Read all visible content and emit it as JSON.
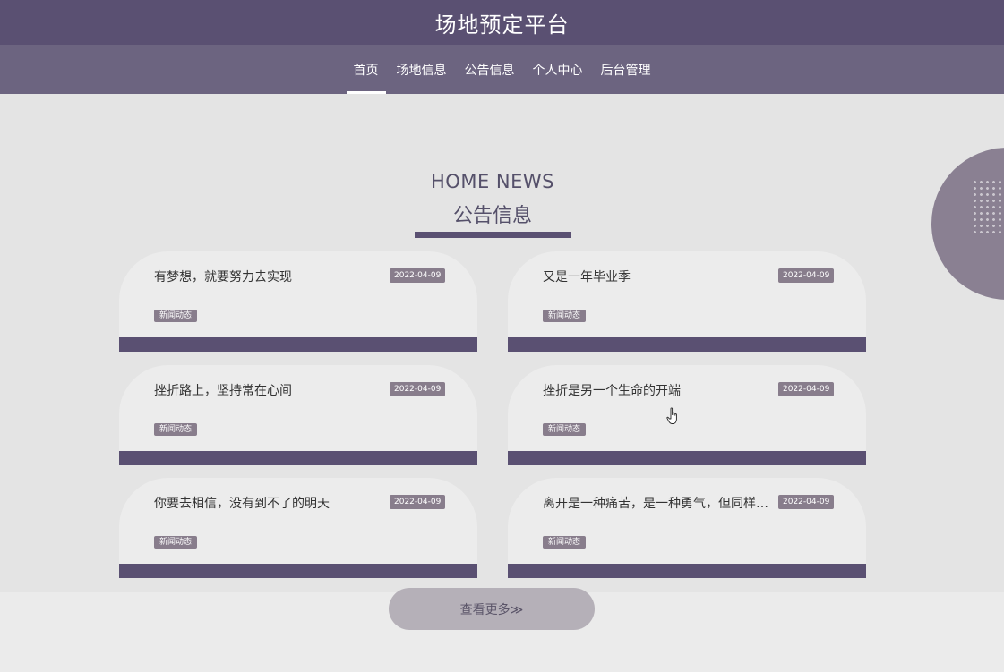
{
  "header": {
    "title": "场地预定平台"
  },
  "nav": [
    {
      "label": "首页",
      "active": true
    },
    {
      "label": "场地信息",
      "active": false
    },
    {
      "label": "公告信息",
      "active": false
    },
    {
      "label": "个人中心",
      "active": false
    },
    {
      "label": "后台管理",
      "active": false
    }
  ],
  "news": {
    "title_en": "HOME NEWS",
    "title_cn": "公告信息",
    "items": [
      {
        "title": "有梦想，就要努力去实现",
        "date": "2022-04-09",
        "tag": "新闻动态"
      },
      {
        "title": "又是一年毕业季",
        "date": "2022-04-09",
        "tag": "新闻动态"
      },
      {
        "title": "挫折路上，坚持常在心间",
        "date": "2022-04-09",
        "tag": "新闻动态"
      },
      {
        "title": "挫折是另一个生命的开端",
        "date": "2022-04-09",
        "tag": "新闻动态"
      },
      {
        "title": "你要去相信，没有到不了的明天",
        "date": "2022-04-09",
        "tag": "新闻动态"
      },
      {
        "title": "离开是一种痛苦，是一种勇气，但同样…",
        "date": "2022-04-09",
        "tag": "新闻动态"
      }
    ],
    "more_label": "查看更多≫"
  },
  "colors": {
    "primary": "#5a5072",
    "nav_background": "#6c6480",
    "badge": "#887d8c",
    "section_background": "#e4e4e4"
  },
  "icons": {
    "cursor": "hand-pointer-icon"
  }
}
